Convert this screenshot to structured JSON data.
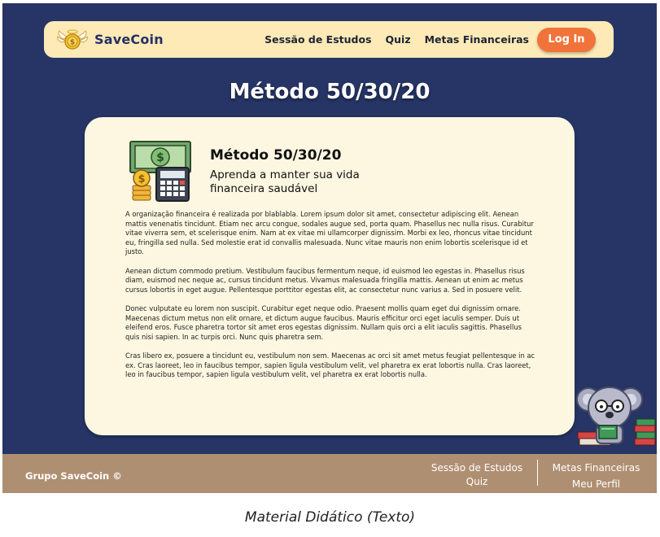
{
  "navbar": {
    "brand_name": "SaveCoin",
    "links": [
      "Sessão de Estudos",
      "Quiz",
      "Metas Financeiras"
    ],
    "login_label": "Log In"
  },
  "page": {
    "title": "Método 50/30/20"
  },
  "card": {
    "heading": "Método 50/30/20",
    "subheading": "Aprenda a manter sua vida financeira saudável",
    "paragraphs": [
      "A organização financeira é realizada por blablabla. Lorem ipsum dolor sit amet, consectetur adipiscing elit. Aenean mattis venenatis tincidunt. Etiam nec arcu congue, sodales augue sed, porta quam. Phasellus nec nulla risus. Curabitur vitae viverra sem, et scelerisque enim. Nam at ex vitae mi ullamcorper dignissim. Morbi ex leo, rhoncus vitae tincidunt eu, fringilla sed nulla. Sed molestie erat id convallis malesuada. Nunc vitae mauris non enim lobortis scelerisque id et justo.",
      "Aenean dictum commodo pretium. Vestibulum faucibus fermentum neque, id euismod leo egestas in. Phasellus risus diam, euismod nec neque ac, cursus tincidunt metus. Vivamus malesuada fringilla mattis. Aenean ut enim ac metus cursus lobortis in eget augue. Pellentesque porttitor egestas elit, ac consectetur nunc varius a. Sed in posuere velit.",
      "Donec vulputate eu lorem non suscipit. Curabitur eget neque odio. Praesent mollis quam eget dui dignissim ornare. Maecenas dictum metus non elit ornare, et dictum augue faucibus. Mauris efficitur orci eget iaculis semper. Duis ut eleifend eros. Fusce pharetra tortor sit amet eros egestas dignissim. Nullam quis orci a elit iaculis sagittis. Phasellus quis nisi sapien. In ac turpis orci. Nunc quis pharetra sem.",
      "Cras libero ex, posuere a tincidunt eu, vestibulum non sem. Maecenas ac orci sit amet metus feugiat pellentesque in ac ex. Cras laoreet, leo in faucibus tempor, sapien ligula vestibulum velit, vel pharetra ex erat lobortis nulla. Cras laoreet, leo in faucibus tempor, sapien ligula vestibulum velit, vel pharetra ex erat lobortis nulla."
    ]
  },
  "footer": {
    "brand": "Grupo SaveCoin ©",
    "links_left": [
      "Sessão de Estudos",
      "Quiz"
    ],
    "links_right": [
      "Metas Financeiras",
      "Meu Perfil"
    ]
  },
  "caption": "Material Didático (Texto)",
  "colors": {
    "background": "#263565",
    "navbar": "#fdeab7",
    "card": "#fdf7e1",
    "accent": "#f0733a",
    "footer": "#af8f72"
  },
  "icons": [
    "winged-coin-logo-icon",
    "money-calculator-icon",
    "koala-mascot-icon"
  ]
}
